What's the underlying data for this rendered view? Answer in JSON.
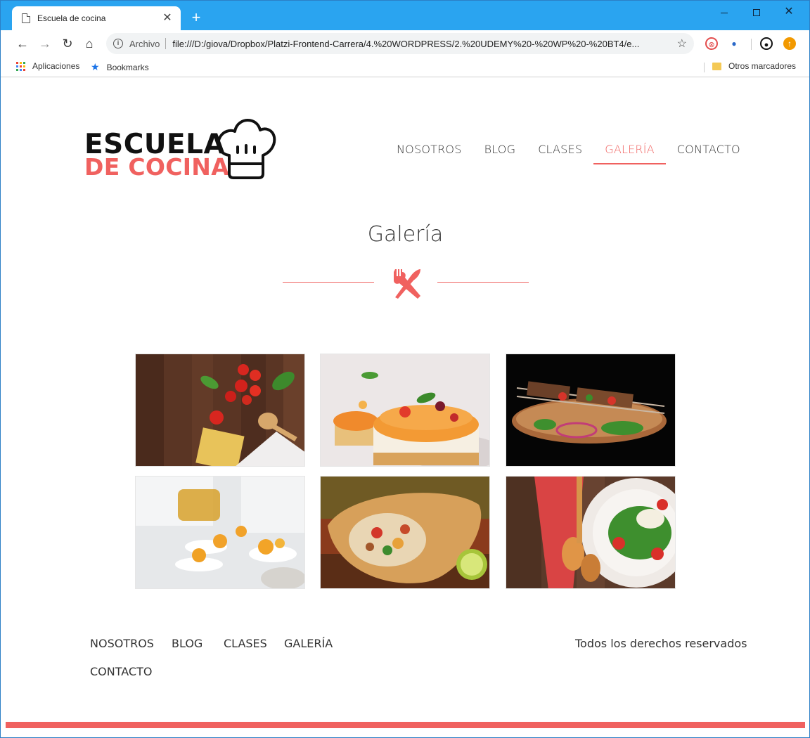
{
  "browser": {
    "tab_title": "Escuela de cocina",
    "tab_close": "✕",
    "new_tab": "+",
    "security_label": "Archivo",
    "url": "file:///D:/giova/Dropbox/Platzi-Frontend-Carrera/4.%20WORDPRESS/2.%20UDEMY%20-%20WP%20-%20BT4/e...",
    "bookmarks": [
      {
        "label": "Aplicaciones",
        "icon": "apps-grid-icon"
      },
      {
        "label": "Bookmarks",
        "icon": "star-icon"
      }
    ],
    "other_bookmarks": "Otros marcadores",
    "colors": {
      "titlebar": "#2aa4f0",
      "omnibox": "#f1f3f4"
    }
  },
  "site": {
    "logo": {
      "line1": "ESCUELA",
      "line2": "DE COCINA",
      "icon": "chef-hat-icon"
    },
    "nav": [
      {
        "label": "NOSOTROS",
        "active": false
      },
      {
        "label": "BLOG",
        "active": false
      },
      {
        "label": "CLASES",
        "active": false
      },
      {
        "label": "GALERÍA",
        "active": true
      },
      {
        "label": "CONTACTO",
        "active": false
      }
    ],
    "page_title": "Galería",
    "divider_icon": "cutlery-icon",
    "gallery": [
      {
        "subject": "tomatoes-basil-spaghetti-wood"
      },
      {
        "subject": "fruit-cheesecake"
      },
      {
        "subject": "grilled-skewers-board"
      },
      {
        "subject": "chef-plating-pumpkins"
      },
      {
        "subject": "burrito-wrap-lime"
      },
      {
        "subject": "green-salad-plate"
      }
    ],
    "footer": {
      "nav": [
        "NOSOTROS",
        "BLOG",
        "CLASES",
        "GALERÍA",
        "CONTACTO"
      ],
      "copyright": "Todos los derechos reservados"
    },
    "colors": {
      "accent": "#f0615f",
      "text": "#333333"
    }
  }
}
